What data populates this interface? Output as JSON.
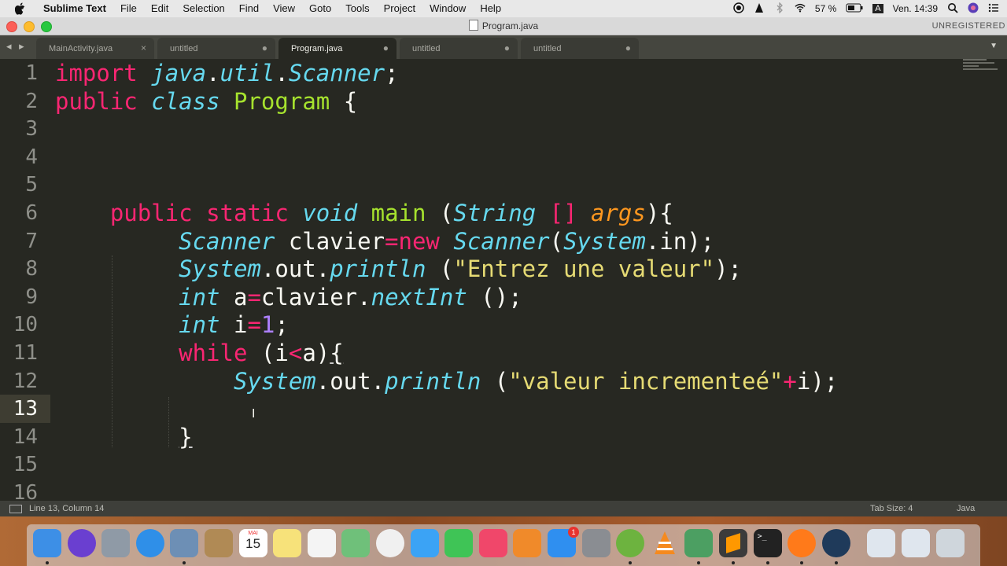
{
  "menubar": {
    "app_name": "Sublime Text",
    "items": [
      "File",
      "Edit",
      "Selection",
      "Find",
      "View",
      "Goto",
      "Tools",
      "Project",
      "Window",
      "Help"
    ],
    "battery": "57 %",
    "input_source": "A",
    "clock": "Ven. 14:39"
  },
  "window": {
    "title": "Program.java",
    "unregistered": "UNREGISTERED"
  },
  "tabs": [
    {
      "label": "MainActivity.java",
      "control": "×"
    },
    {
      "label": "untitled",
      "control": "●"
    },
    {
      "label": "Program.java",
      "control": "●"
    },
    {
      "label": "untitled",
      "control": "●"
    },
    {
      "label": "untitled",
      "control": "●"
    }
  ],
  "editor": {
    "line_numbers": [
      "1",
      "2",
      "3",
      "4",
      "5",
      "6",
      "7",
      "8",
      "9",
      "10",
      "11",
      "12",
      "13",
      "14",
      "15",
      "16"
    ],
    "current_line": 13,
    "lines": [
      [
        {
          "t": "import",
          "c": "kw"
        },
        {
          "t": " "
        },
        {
          "t": "java",
          "c": "ty"
        },
        {
          "t": "."
        },
        {
          "t": "util",
          "c": "ty"
        },
        {
          "t": "."
        },
        {
          "t": "Scanner",
          "c": "ty"
        },
        {
          "t": ";"
        }
      ],
      [
        {
          "t": "public",
          "c": "kw"
        },
        {
          "t": " "
        },
        {
          "t": "class",
          "c": "ty"
        },
        {
          "t": " "
        },
        {
          "t": "Program",
          "c": "cl"
        },
        {
          "t": " {"
        }
      ],
      [],
      [],
      [],
      [
        {
          "t": "    "
        },
        {
          "t": "public",
          "c": "kw"
        },
        {
          "t": " "
        },
        {
          "t": "static",
          "c": "kw"
        },
        {
          "t": " "
        },
        {
          "t": "void",
          "c": "ty"
        },
        {
          "t": " "
        },
        {
          "t": "main",
          "c": "fn"
        },
        {
          "t": " ("
        },
        {
          "t": "String",
          "c": "ty"
        },
        {
          "t": " "
        },
        {
          "t": "[]",
          "c": "kw"
        },
        {
          "t": " "
        },
        {
          "t": "args",
          "c": "pa"
        },
        {
          "t": "){"
        }
      ],
      [
        {
          "t": "         "
        },
        {
          "t": "Scanner",
          "c": "ty"
        },
        {
          "t": " clavier"
        },
        {
          "t": "=",
          "c": "kw"
        },
        {
          "t": "new",
          "c": "kw"
        },
        {
          "t": " "
        },
        {
          "t": "Scanner",
          "c": "ty"
        },
        {
          "t": "("
        },
        {
          "t": "System",
          "c": "ty"
        },
        {
          "t": ".in);"
        }
      ],
      [
        {
          "t": "         "
        },
        {
          "t": "System",
          "c": "ty"
        },
        {
          "t": ".out."
        },
        {
          "t": "println",
          "c": "ty"
        },
        {
          "t": " ("
        },
        {
          "t": "\"Entrez une valeur\"",
          "c": "st"
        },
        {
          "t": ");"
        }
      ],
      [
        {
          "t": "         "
        },
        {
          "t": "int",
          "c": "ty"
        },
        {
          "t": " a"
        },
        {
          "t": "=",
          "c": "kw"
        },
        {
          "t": "clavier."
        },
        {
          "t": "nextInt",
          "c": "ty"
        },
        {
          "t": " ();"
        }
      ],
      [
        {
          "t": "         "
        },
        {
          "t": "int",
          "c": "ty"
        },
        {
          "t": " i"
        },
        {
          "t": "=",
          "c": "kw"
        },
        {
          "t": "1",
          "c": "nm"
        },
        {
          "t": ";"
        }
      ],
      [
        {
          "t": "         "
        },
        {
          "t": "while",
          "c": "kw"
        },
        {
          "t": " (i"
        },
        {
          "t": "<",
          "c": "kw"
        },
        {
          "t": "a)"
        },
        {
          "t": "{",
          "c": "ul"
        }
      ],
      [
        {
          "t": "             "
        },
        {
          "t": "System",
          "c": "ty"
        },
        {
          "t": ".out."
        },
        {
          "t": "println",
          "c": "ty"
        },
        {
          "t": " ("
        },
        {
          "t": "\"valeur incrementeé\"",
          "c": "st"
        },
        {
          "t": "+",
          "c": "kw"
        },
        {
          "t": "i);"
        }
      ],
      [],
      [
        {
          "t": "         "
        },
        {
          "t": "}",
          "c": "ul"
        }
      ],
      [],
      []
    ]
  },
  "statusbar": {
    "position": "Line 13, Column 14",
    "tab_size": "Tab Size: 4",
    "syntax": "Java"
  },
  "dock": {
    "calendar_month": "MAI",
    "calendar_day": "15",
    "appstore_badge": "1",
    "icons": [
      "finder-icon",
      "siri-icon",
      "launchpad-icon",
      "safari-icon",
      "mail-stamp-icon",
      "contacts-icon",
      "calendar-icon",
      "notes-icon",
      "reminders-icon",
      "maps-icon",
      "photos-icon",
      "messages-icon",
      "facetime-icon",
      "music-icon",
      "books-icon",
      "app-store-icon",
      "system-preferences-icon",
      "spring-icon",
      "vlc-icon",
      "android-studio-icon",
      "sublime-text-icon",
      "terminal-icon",
      "firefox-icon",
      "quicktime-icon",
      "downloads-stack-icon",
      "documents-stack-icon",
      "trash-icon"
    ],
    "icon_colors": {
      "finder-icon": "#3d8fe6",
      "siri-icon": "#6a3fd0",
      "launchpad-icon": "#8f9aa6",
      "safari-icon": "#2f8fe8",
      "mail-stamp-icon": "#6d8fb5",
      "contacts-icon": "#b08a55",
      "calendar-icon": "#ffffff",
      "notes-icon": "#f7e27a",
      "reminders-icon": "#f4f4f4",
      "maps-icon": "#6fc07a",
      "photos-icon": "#f0f0f0",
      "messages-icon": "#3ba3f5",
      "facetime-icon": "#3fc456",
      "music-icon": "#f0476a",
      "books-icon": "#f08a2a",
      "app-store-icon": "#2f8ff0",
      "system-preferences-icon": "#8a8d92",
      "spring-icon": "#6db33f",
      "vlc-icon": "#f58a1f",
      "android-studio-icon": "#4c9f62",
      "sublime-text-icon": "#ff9800",
      "terminal-icon": "#222222",
      "firefox-icon": "#ff7a1a",
      "quicktime-icon": "#1f3a5a",
      "downloads-stack-icon": "#dfe6ee",
      "documents-stack-icon": "#dfe6ee",
      "trash-icon": "#cfd6dc"
    }
  }
}
